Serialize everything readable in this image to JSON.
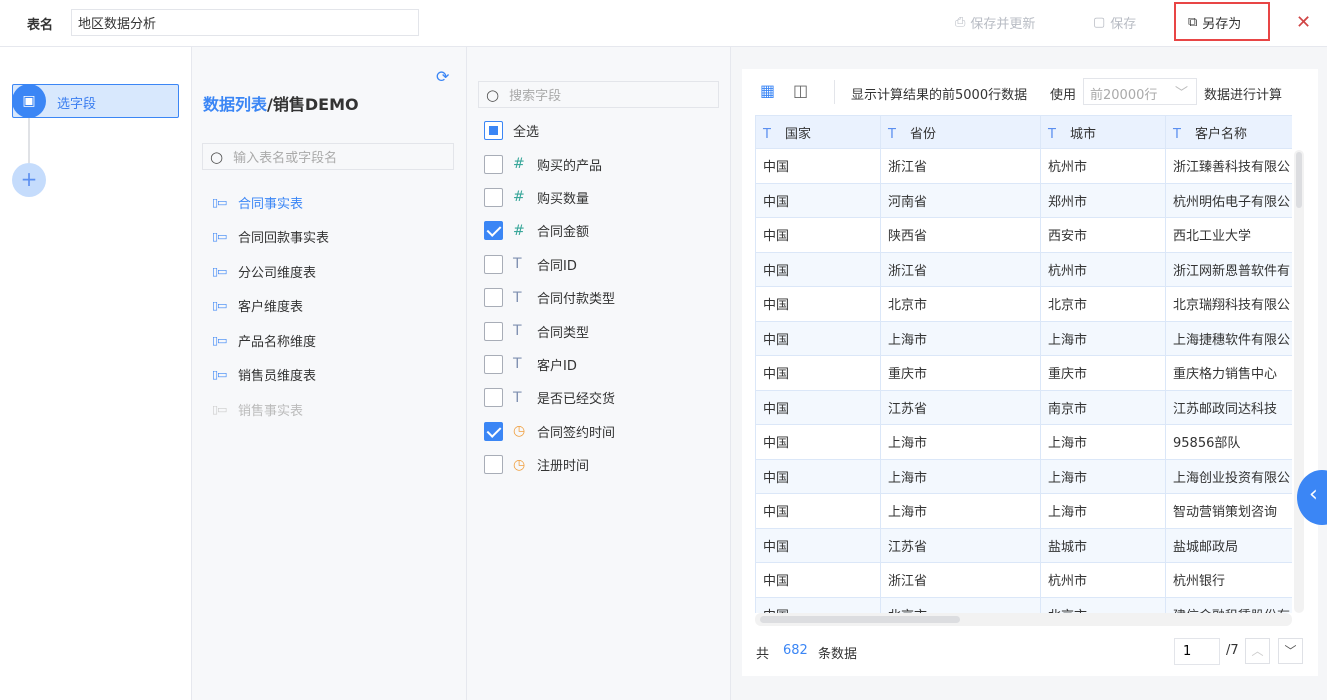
{
  "header": {
    "table_name_label": "表名",
    "table_name_value": "地区数据分析",
    "save_update": "保存并更新",
    "save": "保存",
    "save_as": "另存为"
  },
  "steps": {
    "current": "选字段"
  },
  "source": {
    "breadcrumb_link": "数据列表",
    "breadcrumb_sep": "/",
    "breadcrumb_current": "销售DEMO",
    "search_placeholder": "输入表名或字段名",
    "tables": [
      {
        "label": "合同事实表",
        "state": "selected"
      },
      {
        "label": "合同回款事实表",
        "state": "normal"
      },
      {
        "label": "分公司维度表",
        "state": "normal"
      },
      {
        "label": "客户维度表",
        "state": "normal"
      },
      {
        "label": "产品名称维度",
        "state": "normal"
      },
      {
        "label": "销售员维度表",
        "state": "normal"
      },
      {
        "label": "销售事实表",
        "state": "disabled"
      }
    ]
  },
  "fields": {
    "search_placeholder": "搜索字段",
    "select_all": "全选",
    "select_all_state": "partial",
    "items": [
      {
        "label": "购买的产品",
        "type": "number",
        "checked": false
      },
      {
        "label": "购买数量",
        "type": "number",
        "checked": false
      },
      {
        "label": "合同金额",
        "type": "number",
        "checked": true
      },
      {
        "label": "合同ID",
        "type": "text",
        "checked": false
      },
      {
        "label": "合同付款类型",
        "type": "text",
        "checked": false
      },
      {
        "label": "合同类型",
        "type": "text",
        "checked": false
      },
      {
        "label": "客户ID",
        "type": "text",
        "checked": false
      },
      {
        "label": "是否已经交货",
        "type": "text",
        "checked": false
      },
      {
        "label": "合同签约时间",
        "type": "time",
        "checked": true
      },
      {
        "label": "注册时间",
        "type": "time",
        "checked": false
      }
    ]
  },
  "preview": {
    "info": "显示计算结果的前5000行数据",
    "use": "使用",
    "rows_option": "前20000行",
    "calc": "数据进行计算",
    "columns": [
      "国家",
      "省份",
      "城市",
      "客户名称"
    ],
    "rows": [
      [
        "中国",
        "浙江省",
        "杭州市",
        "浙江臻善科技有限公"
      ],
      [
        "中国",
        "河南省",
        "郑州市",
        "杭州明佑电子有限公"
      ],
      [
        "中国",
        "陕西省",
        "西安市",
        "西北工业大学"
      ],
      [
        "中国",
        "浙江省",
        "杭州市",
        "浙江网新恩普软件有"
      ],
      [
        "中国",
        "北京市",
        "北京市",
        "北京瑞翔科技有限公"
      ],
      [
        "中国",
        "上海市",
        "上海市",
        "上海捷穗软件有限公"
      ],
      [
        "中国",
        "重庆市",
        "重庆市",
        "重庆格力销售中心"
      ],
      [
        "中国",
        "江苏省",
        "南京市",
        "江苏邮政同达科技"
      ],
      [
        "中国",
        "上海市",
        "上海市",
        "95856部队"
      ],
      [
        "中国",
        "上海市",
        "上海市",
        "上海创业投资有限公"
      ],
      [
        "中国",
        "上海市",
        "上海市",
        "智动营销策划咨询"
      ],
      [
        "中国",
        "江苏省",
        "盐城市",
        "盐城邮政局"
      ],
      [
        "中国",
        "浙江省",
        "杭州市",
        "杭州银行"
      ],
      [
        "中国",
        "北京市",
        "北京市",
        "建信金融租赁股份有"
      ]
    ],
    "total_prefix": "共",
    "total": "682",
    "total_suffix": "条数据",
    "page": "1",
    "page_total": "/7"
  },
  "colors": {
    "accent": "#3b86f5",
    "highlight": "#e84545"
  }
}
